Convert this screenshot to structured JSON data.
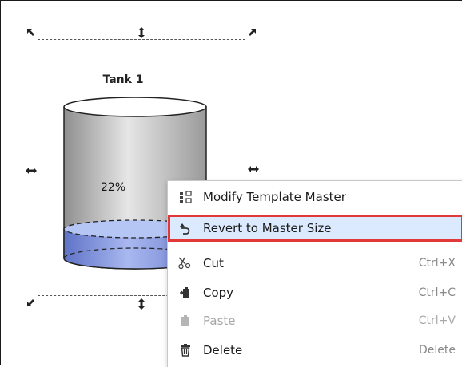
{
  "template": {
    "title": "Tank 1",
    "level_text": "22%",
    "level": 0.22
  },
  "context_menu": {
    "items": [
      {
        "label": "Modify Template Master",
        "shortcut": "",
        "icon": "template-icon",
        "enabled": true
      },
      {
        "label": "Revert to Master Size",
        "shortcut": "",
        "icon": "revert-icon",
        "enabled": true,
        "highlighted": true
      },
      {
        "label": "Cut",
        "shortcut": "Ctrl+X",
        "icon": "scissors-icon",
        "enabled": true
      },
      {
        "label": "Copy",
        "shortcut": "Ctrl+C",
        "icon": "copy-icon",
        "enabled": true
      },
      {
        "label": "Paste",
        "shortcut": "Ctrl+V",
        "icon": "paste-icon",
        "enabled": false
      },
      {
        "label": "Delete",
        "shortcut": "Delete",
        "icon": "trash-icon",
        "enabled": true
      }
    ]
  },
  "colors": {
    "highlight_bg": "#dbeaff",
    "highlight_border": "#e23838",
    "liquid": "#7e93dd",
    "tank_body": "#b0b0b0"
  }
}
